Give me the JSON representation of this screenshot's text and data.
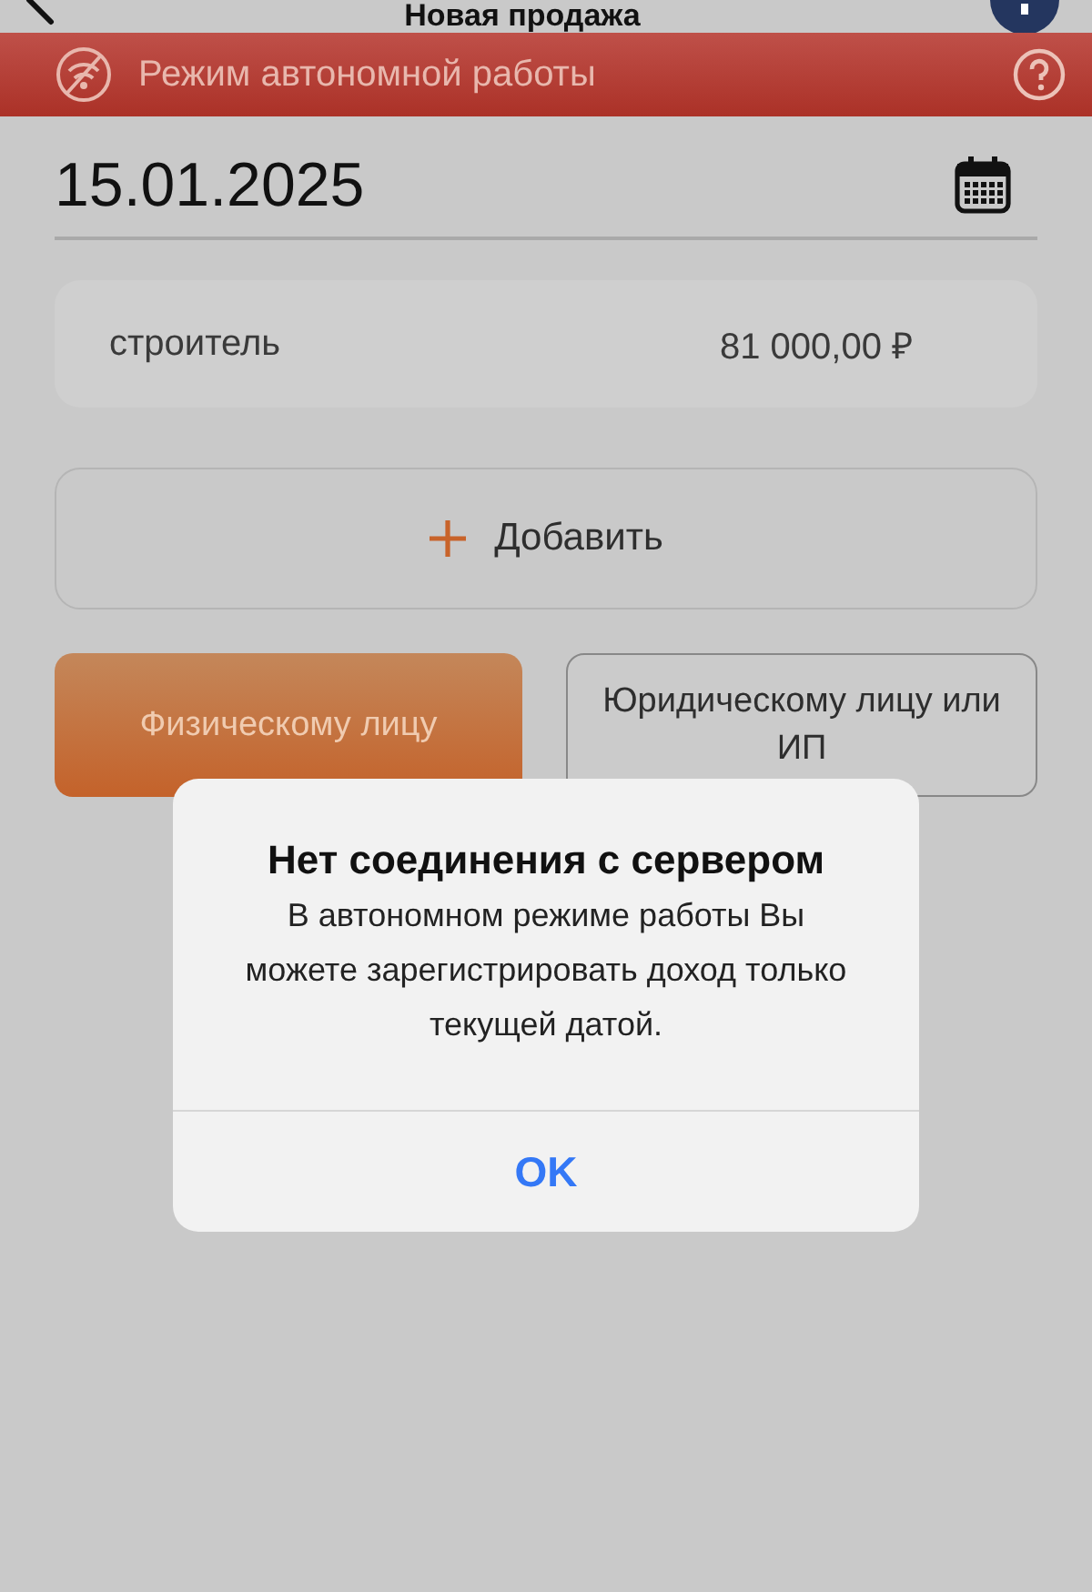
{
  "header": {
    "title": "Новая продажа"
  },
  "offline_banner": {
    "text": "Режим автономной работы"
  },
  "sale_date": {
    "value": "15.01.2025"
  },
  "items": [
    {
      "name": "строитель",
      "amount": "81 000,00 ₽"
    }
  ],
  "add_button": {
    "label": "Добавить"
  },
  "buyer_types": [
    {
      "label": "Физическому лицу",
      "selected": true
    },
    {
      "label": "Юридическому лицу или ИП",
      "selected": false
    }
  ],
  "alert": {
    "title": "Нет соединения с сервером",
    "message": "В автономном режиме работы Вы можете зарегистрировать доход только текущей датой.",
    "button": "OK"
  }
}
